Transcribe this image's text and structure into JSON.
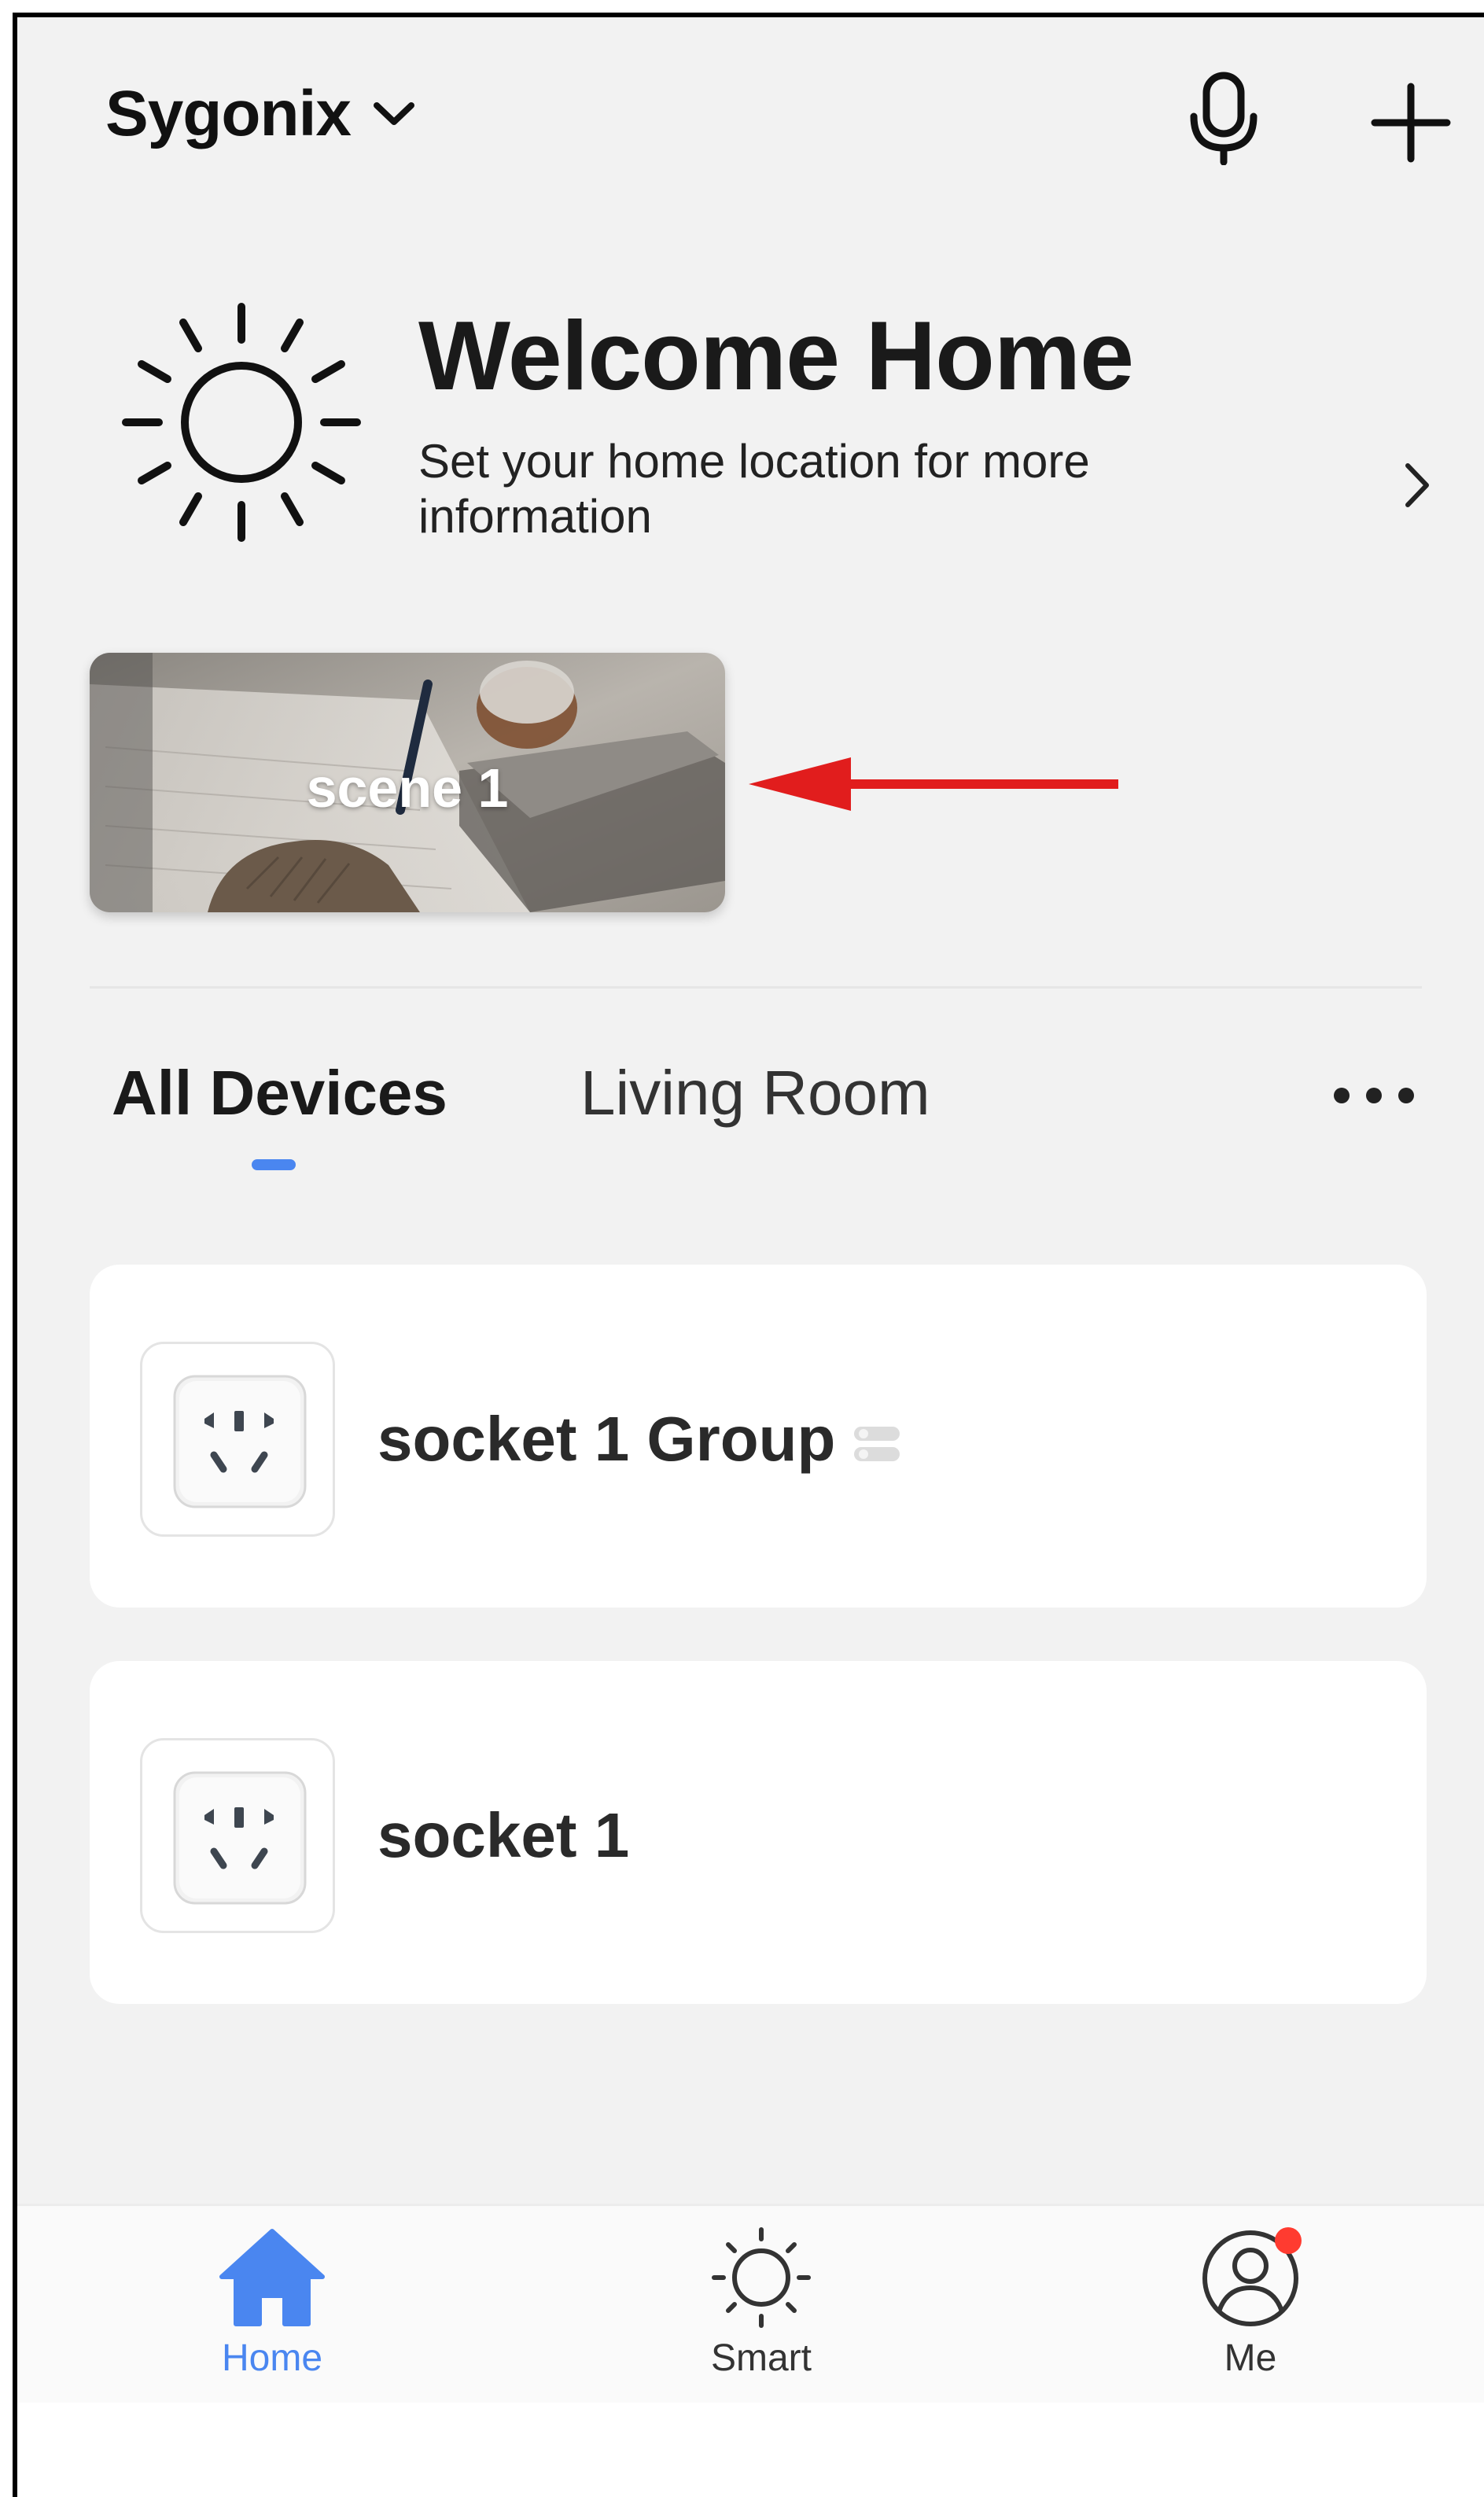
{
  "header": {
    "home_name": "Sygonix",
    "icons": [
      "chevron-down-icon",
      "microphone-icon",
      "plus-icon"
    ]
  },
  "welcome": {
    "title": "Welcome Home",
    "subtitle": "Set your home location for more information",
    "icon": "sun-icon"
  },
  "scene": {
    "label": "scene 1",
    "annotation_arrow_color": "#e11d1d"
  },
  "tabs": {
    "items": [
      "All Devices",
      "Living Room"
    ],
    "active": "All Devices",
    "indicator_color": "#4a86f0"
  },
  "devices": [
    {
      "name": "socket 1 Group",
      "icon": "socket-icon",
      "badge": "group-icon"
    },
    {
      "name": "socket 1",
      "icon": "socket-icon"
    }
  ],
  "bottom_nav": {
    "items": [
      {
        "label": "Home",
        "icon": "home-icon",
        "active": true
      },
      {
        "label": "Smart",
        "icon": "sun-icon",
        "active": false
      },
      {
        "label": "Me",
        "icon": "user-icon",
        "active": false,
        "notification_dot": true
      }
    ],
    "active_color": "#4a86f0",
    "notification_color": "#ff3b30"
  }
}
